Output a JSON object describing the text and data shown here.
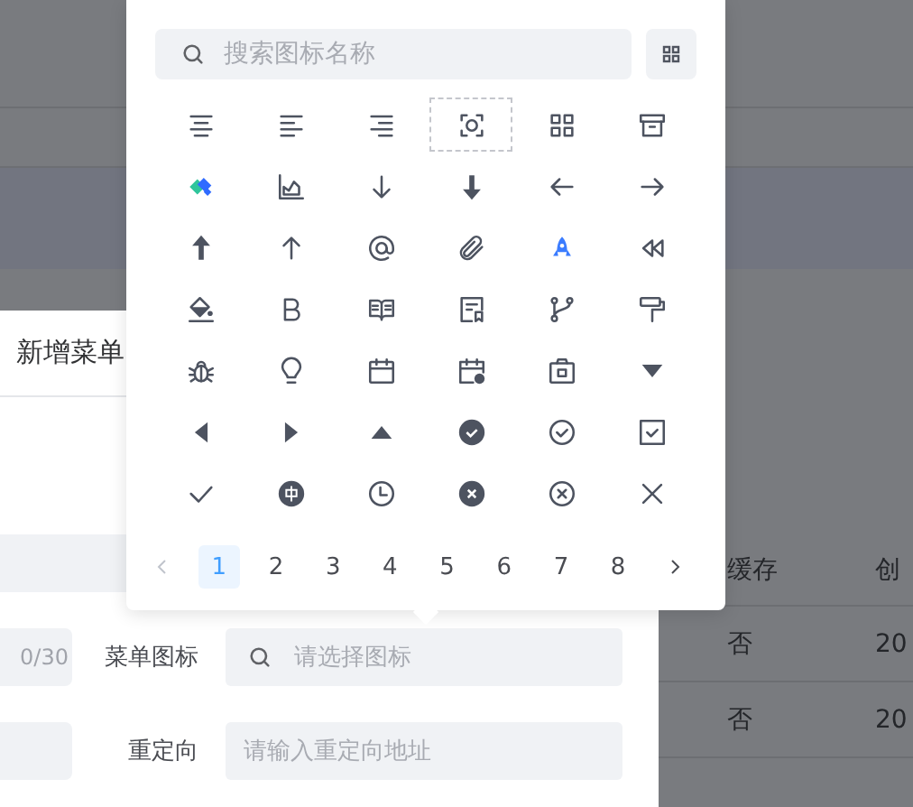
{
  "dialog": {
    "title": "新增菜单",
    "form_rows": [
      {
        "kind": "blank"
      },
      {
        "kind": "icon_select",
        "counter": "0/30",
        "label": "菜单图标",
        "placeholder": "请选择图标"
      },
      {
        "kind": "text_input",
        "label": "重定向",
        "placeholder": "请输入重定向地址"
      }
    ]
  },
  "table": {
    "columns": [
      "缓存",
      "创"
    ],
    "rows": [
      [
        "否",
        "20"
      ],
      [
        "否",
        "20"
      ]
    ]
  },
  "icon_picker": {
    "search": {
      "placeholder": "搜索图标名称"
    },
    "icons": [
      {
        "selected": false
      },
      {
        "selected": false
      },
      {
        "selected": false
      },
      {
        "selected": true
      },
      {
        "selected": false
      },
      {
        "selected": false
      },
      {
        "selected": false
      },
      {
        "selected": false
      },
      {
        "selected": false
      },
      {
        "selected": false
      },
      {
        "selected": false
      },
      {
        "selected": false
      },
      {
        "selected": false
      },
      {
        "selected": false
      },
      {
        "selected": false
      },
      {
        "selected": false
      },
      {
        "selected": false
      },
      {
        "selected": false
      },
      {
        "selected": false
      },
      {
        "selected": false
      },
      {
        "selected": false
      },
      {
        "selected": false
      },
      {
        "selected": false
      },
      {
        "selected": false
      },
      {
        "selected": false
      },
      {
        "selected": false
      },
      {
        "selected": false
      },
      {
        "selected": false
      },
      {
        "selected": false
      },
      {
        "selected": false
      },
      {
        "selected": false
      },
      {
        "selected": false
      },
      {
        "selected": false
      },
      {
        "selected": false
      },
      {
        "selected": false
      },
      {
        "selected": false
      },
      {
        "selected": false
      },
      {
        "selected": false
      },
      {
        "selected": false
      },
      {
        "selected": false
      },
      {
        "selected": false
      },
      {
        "selected": false
      }
    ],
    "pagination": {
      "prev": {
        "disabled": true
      },
      "next": {
        "disabled": false
      },
      "pages": [
        {
          "label": "1",
          "selected": true
        },
        {
          "label": "2",
          "selected": false
        },
        {
          "label": "3",
          "selected": false
        },
        {
          "label": "4",
          "selected": false
        },
        {
          "label": "5",
          "selected": false
        },
        {
          "label": "6",
          "selected": false
        },
        {
          "label": "7",
          "selected": false
        },
        {
          "label": "8",
          "selected": false
        }
      ]
    }
  }
}
